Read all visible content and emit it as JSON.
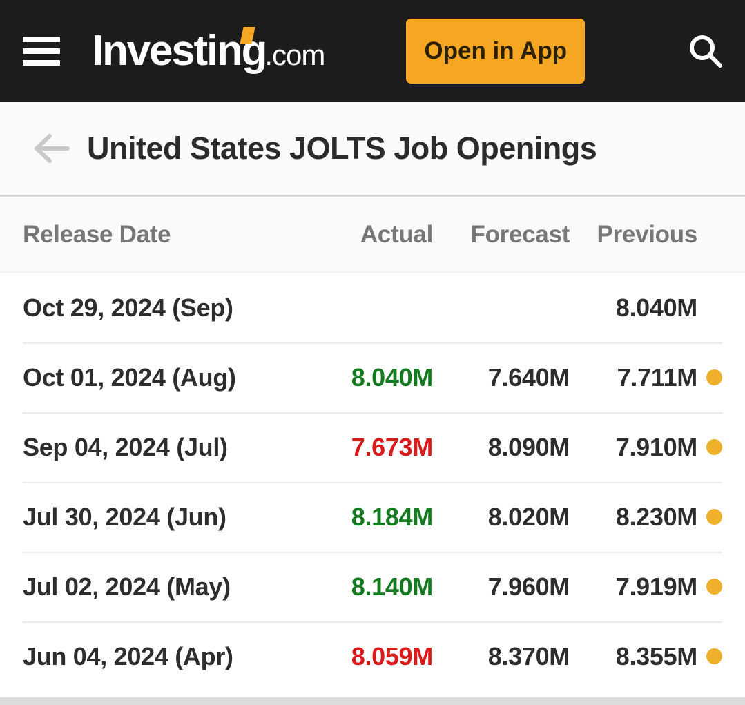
{
  "topbar": {
    "menu_icon": "hamburger-menu-icon",
    "logo_main": "Investing",
    "logo_suffix": ".com",
    "open_in_app_label": "Open in App",
    "search_icon": "search-icon",
    "background_color": "#1c1c1c",
    "accent_color": "#f5a623"
  },
  "header": {
    "back_icon": "back-arrow-icon",
    "title": "United States JOLTS Job Openings"
  },
  "table": {
    "columns": {
      "date": "Release Date",
      "actual": "Actual",
      "forecast": "Forecast",
      "previous": "Previous"
    },
    "colors": {
      "actual_up": "#137a1f",
      "actual_down": "#d81a1a",
      "indicator_dot": "#efb02c"
    },
    "rows": [
      {
        "date": "Oct 29, 2024 (Sep)",
        "actual": "",
        "actual_state": "none",
        "forecast": "",
        "previous": "8.040M",
        "has_dot": false
      },
      {
        "date": "Oct 01, 2024 (Aug)",
        "actual": "8.040M",
        "actual_state": "up",
        "forecast": "7.640M",
        "previous": "7.711M",
        "has_dot": true
      },
      {
        "date": "Sep 04, 2024 (Jul)",
        "actual": "7.673M",
        "actual_state": "down",
        "forecast": "8.090M",
        "previous": "7.910M",
        "has_dot": true
      },
      {
        "date": "Jul 30, 2024 (Jun)",
        "actual": "8.184M",
        "actual_state": "up",
        "forecast": "8.020M",
        "previous": "8.230M",
        "has_dot": true
      },
      {
        "date": "Jul 02, 2024 (May)",
        "actual": "8.140M",
        "actual_state": "up",
        "forecast": "7.960M",
        "previous": "7.919M",
        "has_dot": true
      },
      {
        "date": "Jun 04, 2024 (Apr)",
        "actual": "8.059M",
        "actual_state": "down",
        "forecast": "8.370M",
        "previous": "8.355M",
        "has_dot": true
      }
    ]
  }
}
